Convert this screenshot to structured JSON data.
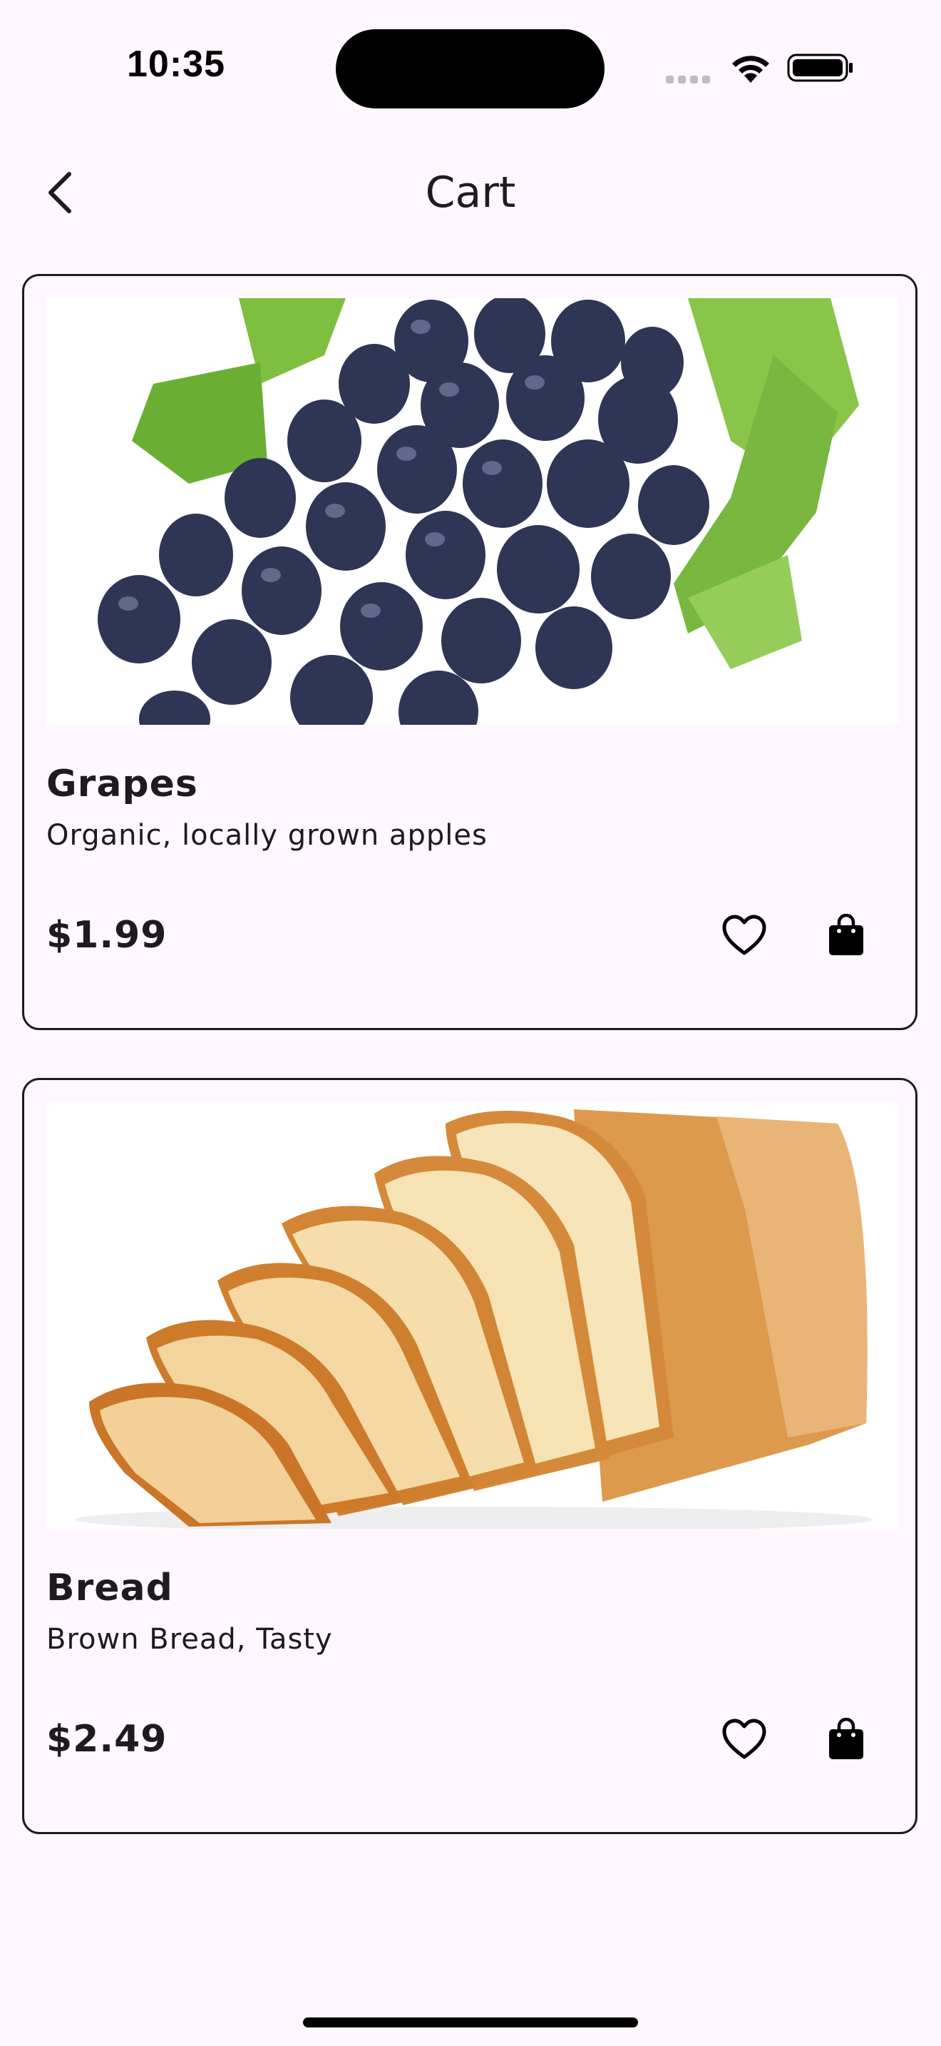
{
  "status_bar": {
    "time": "10:35",
    "icons": [
      "cellular-signal-icon",
      "wifi-icon",
      "battery-icon"
    ]
  },
  "header": {
    "title": "Cart",
    "back_icon": "chevron-left-icon"
  },
  "cart_items": [
    {
      "name": "Grapes",
      "description": "Organic, locally grown apples",
      "price": "$1.99",
      "image": "grapes-image",
      "favorite_icon": "heart-outline-icon",
      "bag_icon": "shopping-bag-icon"
    },
    {
      "name": "Bread",
      "description": "Brown Bread, Tasty",
      "price": "$2.49",
      "image": "bread-image",
      "favorite_icon": "heart-outline-icon",
      "bag_icon": "shopping-bag-icon"
    }
  ],
  "colors": {
    "background": "#fef7fe",
    "text": "#1d1b20",
    "card_border": "#1d1b20"
  }
}
